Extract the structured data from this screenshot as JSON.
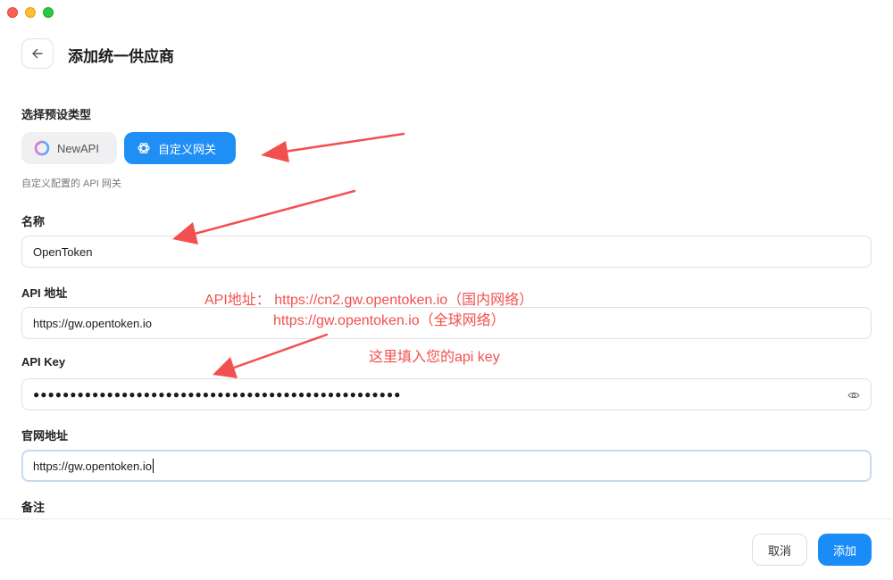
{
  "header": {
    "title": "添加统一供应商"
  },
  "preset": {
    "section_label": "选择预设类型",
    "options": [
      {
        "label": "NewAPI",
        "icon": "newapi-logo-icon"
      },
      {
        "label": "自定义网关",
        "icon": "openai-logo-icon",
        "selected": true
      }
    ],
    "hint": "自定义配置的 API 网关"
  },
  "form": {
    "name": {
      "label": "名称",
      "value": "OpenToken"
    },
    "api_url": {
      "label": "API 地址",
      "value": "https://gw.opentoken.io"
    },
    "api_key": {
      "label": "API Key",
      "value": "●●●●●●●●●●●●●●●●●●●●●●●●●●●●●●●●●●●●●●●●●●●●●●●●●●"
    },
    "website": {
      "label": "官网地址",
      "value": "https://gw.opentoken.io"
    },
    "notes": {
      "label": "备注"
    }
  },
  "footer": {
    "cancel_label": "取消",
    "add_label": "添加"
  },
  "annotations": {
    "api_line1": "API地址： https://cn2.gw.opentoken.io（国内网络）",
    "api_line2": "https://gw.opentoken.io（全球网络）",
    "key_hint": "这里填入您的api key"
  },
  "colors": {
    "accent": "#1f8ff5",
    "annotation": "#f2504f"
  }
}
